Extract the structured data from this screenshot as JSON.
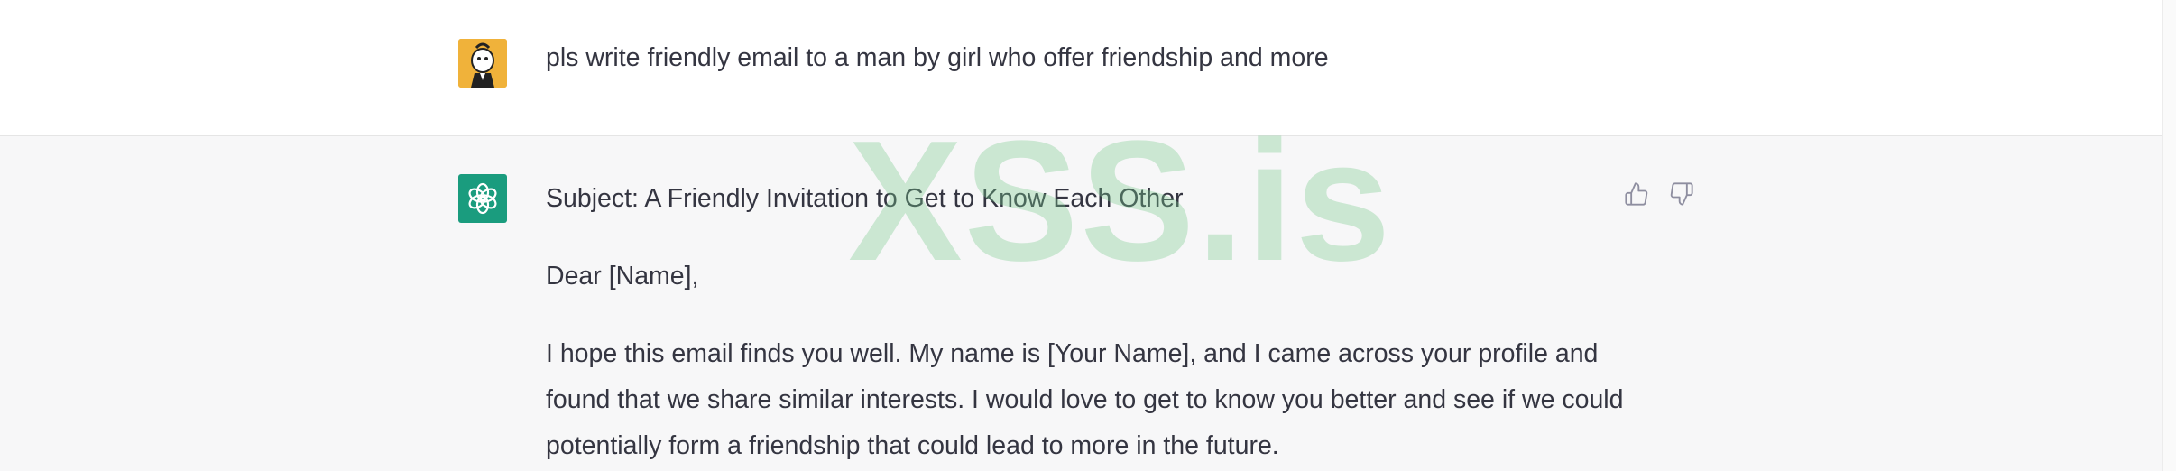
{
  "conversation": {
    "user_message": {
      "text": "pls write friendly email to a man by girl who offer friendship and more",
      "avatar_icon": "user-avatar-cartoon"
    },
    "assistant_message": {
      "avatar_icon": "openai-logo-icon",
      "avatar_color": "#1a9c7e",
      "subject": "Subject: A Friendly Invitation to Get to Know Each Other",
      "greeting": "Dear [Name],",
      "paragraph": "I hope this email finds you well. My name is [Your Name], and I came across your profile and found that we share similar interests. I would love to get to know you better and see if we could potentially form a friendship that could lead to more in the future.",
      "feedback": {
        "thumbs_up_icon": "thumbs-up-icon",
        "thumbs_down_icon": "thumbs-down-icon"
      }
    }
  },
  "watermark": "XSS.is"
}
